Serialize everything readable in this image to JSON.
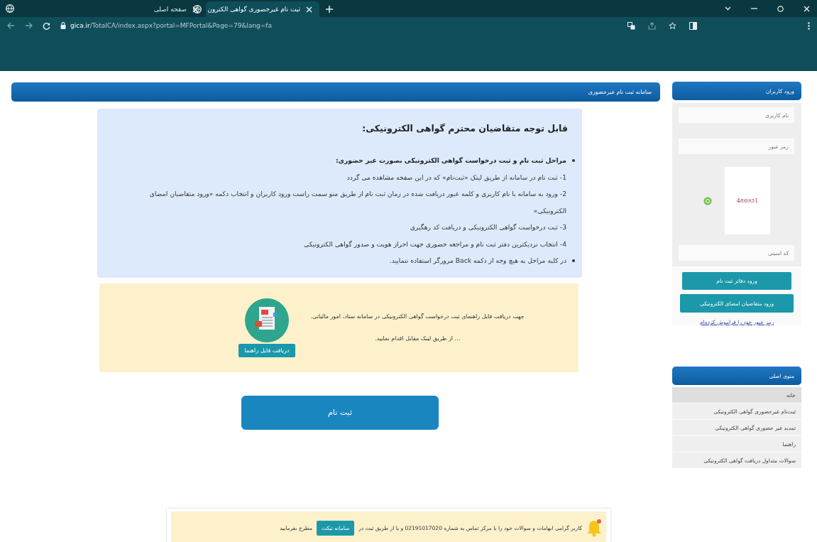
{
  "browser": {
    "tabs": [
      {
        "title": "ثبت نام غیرحضوری گواهی الکترون",
        "selected": true
      },
      {
        "title": "صفحه اصلی",
        "selected": false
      }
    ],
    "url_domain": "gica.ir",
    "url_path": "/TotalCA/index.aspx?portal=MFPortal&Page=79&lang=fa"
  },
  "header": {
    "title": "سامانه ثبت نام غیرحضوری"
  },
  "notice": {
    "title": "قابل توجه متقاضیان محترم گواهی الکترونیکی:",
    "items": [
      {
        "kind": "heading",
        "text": "مراحل ثبت نام و ثبت درخواست گواهی الکترونیکی بصورت غیر حضوری:"
      },
      {
        "kind": "step",
        "text": "1- ثبت نام در سامانه از طریق لینک «ثبت‌نام» که در این صفحه مشاهده می گردد"
      },
      {
        "kind": "step",
        "text": "2- ورود به سامانه با نام کاربری و کلمه عبور دریافت شده در زمان ثبت نام از طریق منو سمت راست ورود کاربران و انتخاب دکمه «ورود متقاضیان امضای الکترونیکی»"
      },
      {
        "kind": "step",
        "text": "3- ثبت درخواست گواهی الکترونیکی و دریافت کد رهگیری"
      },
      {
        "kind": "step",
        "text": "4- انتخاب نزدیکترین دفتر ثبت نام و مراجعه حضوری جهت احراز هویت و صدور گواهی الکترونیکی"
      },
      {
        "kind": "bullet",
        "text": "در کلیه مراحل به هیچ وجه از دکمه Back مرورگر استفاده ننمایید."
      }
    ]
  },
  "guide": {
    "lines": [
      "جهت دریافت فایل راهنمای ثبت درخواست گواهی الکترونیکی در سامانه ستاد، امور مالیاتی.",
      "... از طریق لینک مقابل اقدام نمایید."
    ],
    "button": "دریافت فایل راهنما"
  },
  "register_button": "ثبت نام",
  "footer": {
    "text_before": "کاربر گرامی ابهامات و سوالات خود را با مرکز تماس به شماره 02191017020 و یا از طریق ثبت در",
    "button": "سامانه تیکت",
    "text_after": "مطرح بفرمایید"
  },
  "login": {
    "title": "ورود کاربران",
    "fields": [
      {
        "placeholder": "نام کاربری"
      },
      {
        "placeholder": "رمز عبور"
      }
    ],
    "captcha": "486931",
    "captcha_field": {
      "placeholder": "کد امنیتی"
    },
    "buttons": [
      "ورود دفاتر ثبت نام",
      "ورود متقاضیان امضای الکترونیکی"
    ],
    "link": "رمز عبور خود را فراموش کرده‌ام"
  },
  "menu": {
    "title": "منوی اصلی",
    "items": [
      {
        "label": "خانه",
        "selected": true
      },
      {
        "label": "ثبت‌نام غیرحضوری گواهی الکترونیکی",
        "selected": false
      },
      {
        "label": "تمدید غیر حضوری گواهی الکترونیکی",
        "selected": false
      },
      {
        "label": "راهنما",
        "selected": false
      },
      {
        "label": "سوالات متداول دریافت گواهی الکترونیکی",
        "selected": false
      }
    ]
  }
}
